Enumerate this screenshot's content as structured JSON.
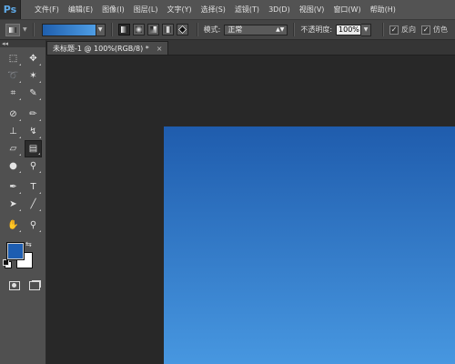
{
  "app": {
    "logo_text": "Ps"
  },
  "menu": [
    "文件(F)",
    "编辑(E)",
    "图像(I)",
    "图层(L)",
    "文字(Y)",
    "选择(S)",
    "滤镜(T)",
    "3D(D)",
    "视图(V)",
    "窗口(W)",
    "帮助(H)"
  ],
  "options": {
    "mode_label": "模式:",
    "mode_value": "正常",
    "opacity_label": "不透明度:",
    "opacity_value": "100%",
    "reverse_label": "反向",
    "dither_label": "仿色",
    "gradient_colors": {
      "start": "#1f5fae",
      "end": "#4e9de4"
    }
  },
  "tools_panel": {
    "collapse_glyph": "◂◂",
    "tools": [
      "marquee-icon",
      "move-icon",
      "lasso-icon",
      "magic-wand-icon",
      "crop-icon",
      "eyedropper-icon",
      "healing-brush-icon",
      "brush-icon",
      "clone-stamp-icon",
      "history-brush-icon",
      "eraser-icon",
      "gradient-icon",
      "blur-icon",
      "dodge-icon",
      "pen-icon",
      "type-icon",
      "path-selection-icon",
      "line-icon",
      "hand-icon",
      "zoom-icon"
    ],
    "foreground_color": "#1d5db1",
    "background_color": "#ffffff"
  },
  "document": {
    "tab_title": "未标题-1 @ 100%(RGB/8) *",
    "close_glyph": "×",
    "canvas_gradient": {
      "top": "#1f5cad",
      "bottom": "#4797e0"
    }
  }
}
